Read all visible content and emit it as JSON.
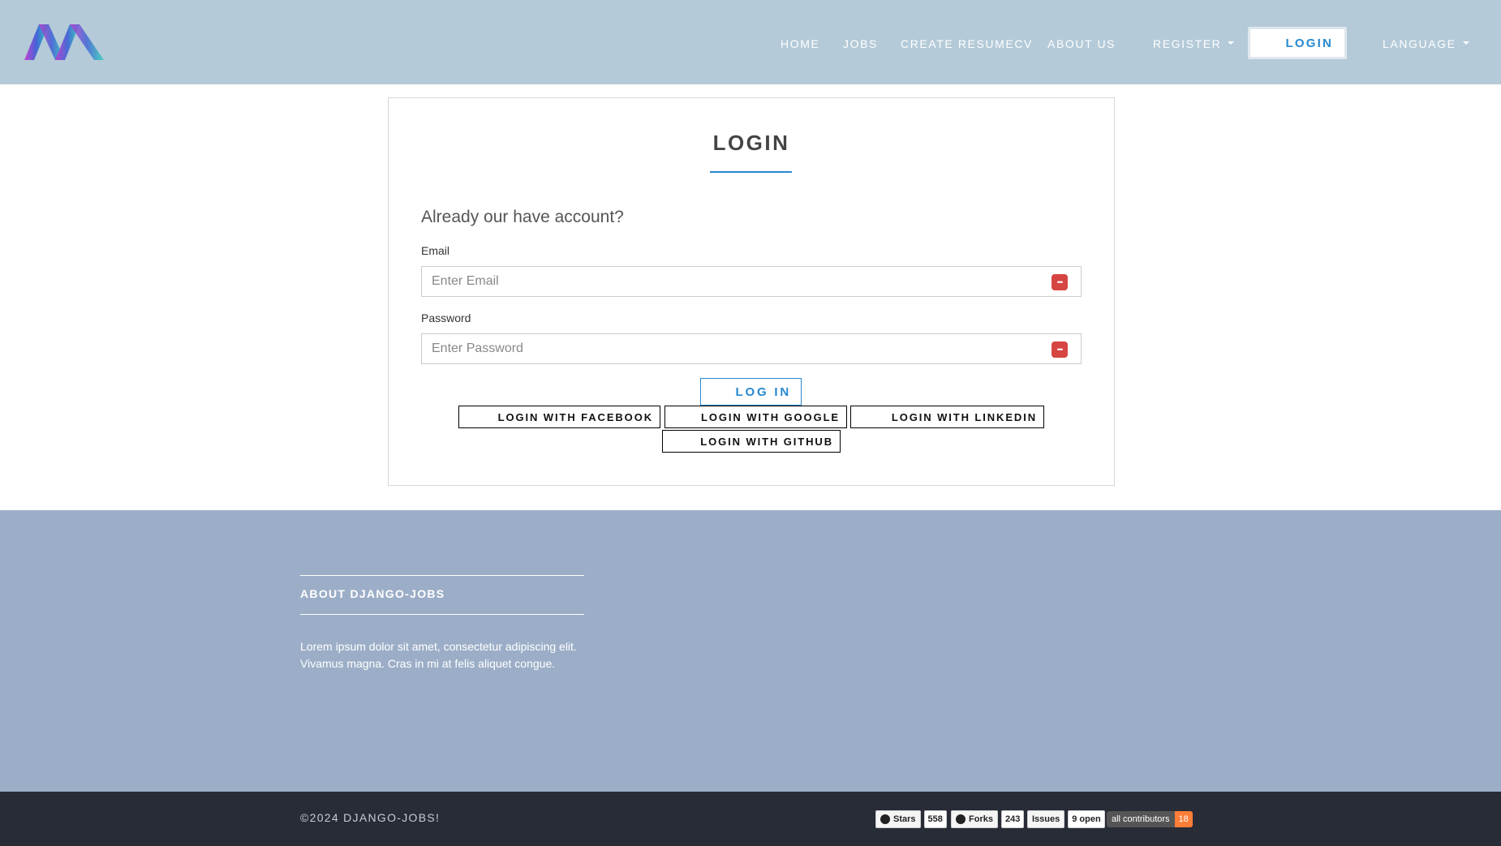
{
  "header": {
    "nav": {
      "home": "HOME",
      "jobs": "JOBS",
      "create_resume": "CREATE RESUMECV",
      "about": "ABOUT US",
      "register": "REGISTER",
      "login": "LOGIN",
      "language": "LANGUAGE"
    }
  },
  "login_card": {
    "title": "LOGIN",
    "subhead": "Already our have account?",
    "email": {
      "label": "Email",
      "placeholder": "Enter Email"
    },
    "password": {
      "label": "Password",
      "placeholder": "Enter Password"
    },
    "submit": "LOG IN",
    "social": {
      "facebook": "LOGIN WITH FACEBOOK",
      "google": "LOGIN WITH GOOGLE",
      "linkedin": "LOGIN WITH LINKEDIN",
      "github": "LOGIN WITH GITHUB"
    }
  },
  "footer": {
    "about_title": "ABOUT DJANGO-JOBS",
    "about_text": "Lorem ipsum dolor sit amet, consectetur adipiscing elit. Vivamus magna. Cras in mi at felis aliquet congue.",
    "copyright": "©2024 DJANGO-JOBS!",
    "badges": {
      "stars_label": "Stars",
      "stars_count": "558",
      "forks_label": "Forks",
      "forks_count": "243",
      "issues_label": "Issues",
      "issues_count": "9 open",
      "contributors_label": "all contributors",
      "contributors_count": "18"
    }
  },
  "colors": {
    "header_bg": "#b4cad8",
    "accent": "#2788d0",
    "footer_bg": "#9caec7",
    "bottombar_bg": "#282c37",
    "password_icon": "#d64541"
  },
  "icons": [
    "logo-mark",
    "caret-down-icon",
    "password-manager-icon",
    "github-icon"
  ]
}
